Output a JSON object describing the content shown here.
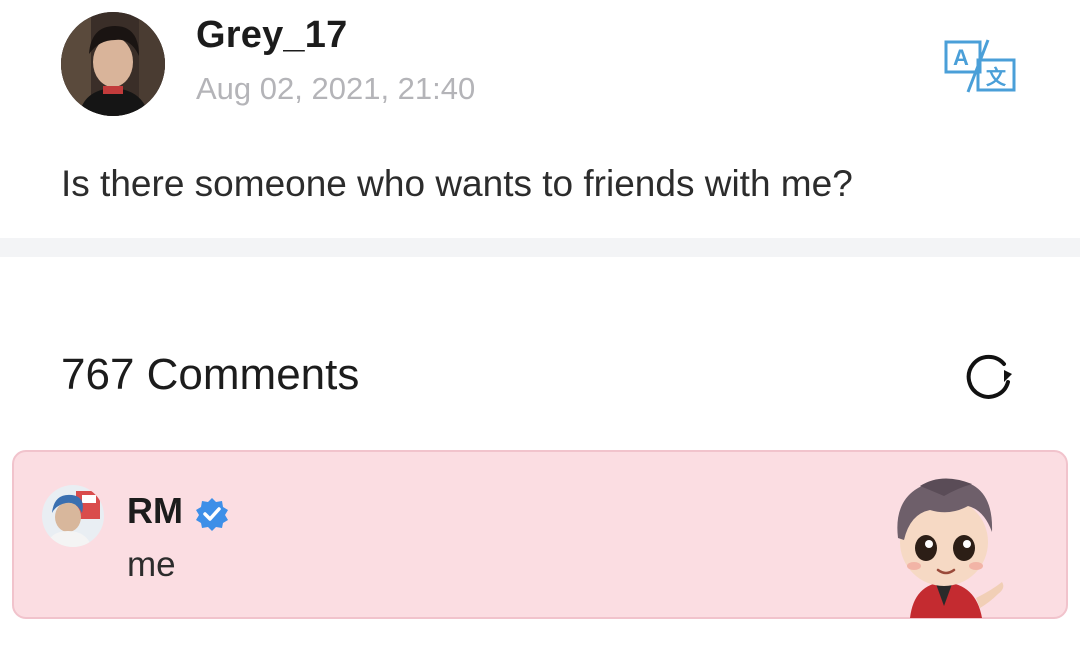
{
  "post": {
    "username": "Grey_17",
    "timestamp": "Aug 02, 2021, 21:40",
    "body": "Is there someone who wants to friends with me?",
    "translate_icon": "translate-icon"
  },
  "comments": {
    "count_label": "767 Comments",
    "refresh_icon": "refresh-icon",
    "items": [
      {
        "author": "RM",
        "verified": true,
        "text": "me",
        "highlight_color": "#fbdde2",
        "sticker": "character-sticker"
      }
    ]
  },
  "colors": {
    "accent_blue": "#4a9fd8",
    "verified_blue": "#3d8fe8",
    "highlight_pink": "#fbdde2",
    "muted_text": "#b4b4b8"
  }
}
